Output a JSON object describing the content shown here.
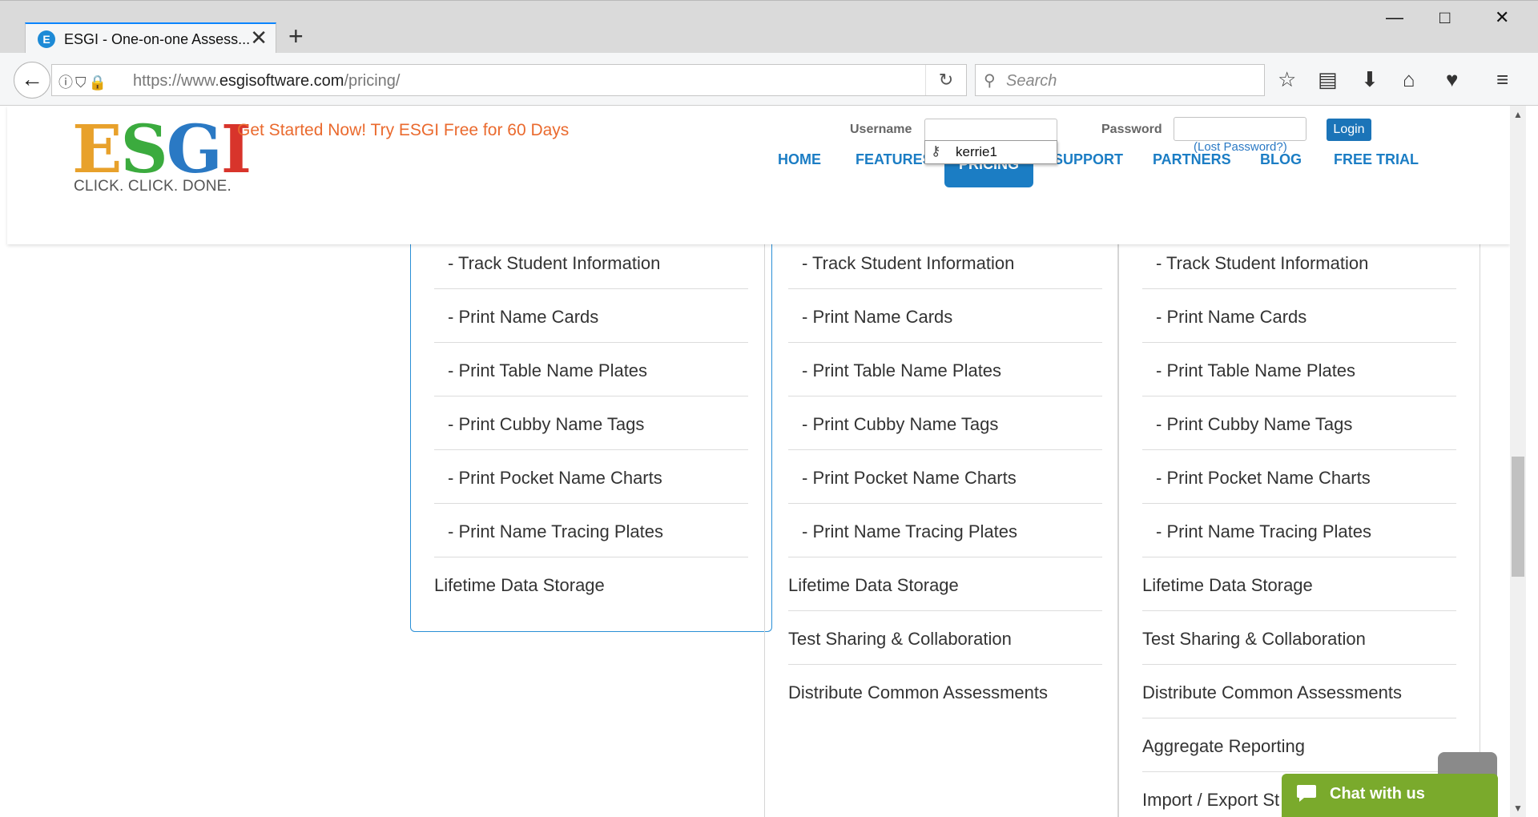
{
  "browser": {
    "tab_title": "ESGI - One-on-one Assess...",
    "tab_favicon": "E",
    "url_prefix": "https://www.",
    "url_domain": "esgisoftware.com",
    "url_path": "/pricing/",
    "search_placeholder": "Search",
    "icons": {
      "back": "←",
      "reload": "↻",
      "search": "🔍",
      "bookmark": "☆",
      "reading_list": "▤",
      "download": "⬇",
      "home": "⌂",
      "pocket": "♥",
      "menu": "≡",
      "minimize": "—",
      "maximize": "□",
      "close": "✕",
      "tab_close": "✕",
      "new_tab": "+"
    }
  },
  "header": {
    "logo_letters": [
      "E",
      "S",
      "G",
      "I"
    ],
    "logo_tagline": "CLICK. CLICK. DONE.",
    "promo": "Get Started Now! Try ESGI Free for 60 Days",
    "username_label": "Username",
    "password_label": "Password",
    "autocomplete_value": "kerrie1",
    "lost_password": "(Lost Password?)",
    "login_label": "Login",
    "nav": [
      "HOME",
      "FEATURES",
      "PRICING",
      "SUPPORT",
      "PARTNERS",
      "BLOG",
      "FREE TRIAL"
    ],
    "active_nav": "PRICING"
  },
  "columns": [
    {
      "border_color": "#2a8fd6",
      "rows": [
        "- Track Student Information",
        "- Print Name Cards",
        "- Print Table Name Plates",
        "- Print Cubby Name Tags",
        "- Print Pocket Name Charts",
        "- Print Name Tracing Plates",
        "Lifetime Data Storage"
      ]
    },
    {
      "border_color": "#d5d5d5",
      "rows": [
        "- Track Student Information",
        "- Print Name Cards",
        "- Print Table Name Plates",
        "- Print Cubby Name Tags",
        "- Print Pocket Name Charts",
        "- Print Name Tracing Plates",
        "Lifetime Data Storage",
        "Test Sharing & Collaboration",
        "Distribute Common Assessments"
      ]
    },
    {
      "border_color": "#d5d5d5",
      "rows": [
        "- Track Student Information",
        "- Print Name Cards",
        "- Print Table Name Plates",
        "- Print Cubby Name Tags",
        "- Print Pocket Name Charts",
        "- Print Name Tracing Plates",
        "Lifetime Data Storage",
        "Test Sharing & Collaboration",
        "Distribute Common Assessments",
        "Aggregate Reporting",
        "Import / Export St"
      ]
    }
  ],
  "chat": {
    "label": "Chat with us",
    "icon": "💬"
  }
}
